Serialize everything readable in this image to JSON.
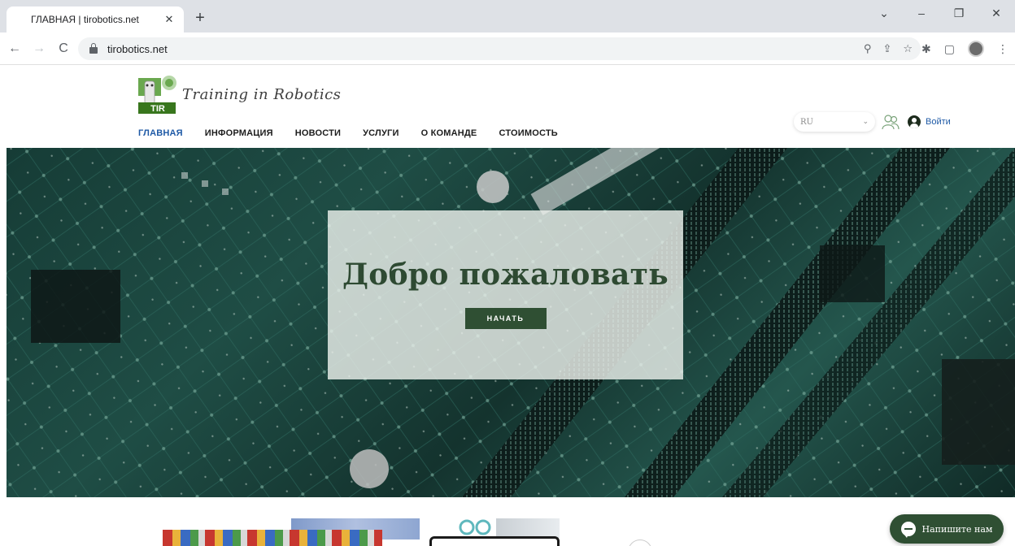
{
  "browser": {
    "tab_title": "ГЛАВНАЯ | tirobotics.net",
    "tab_close": "✕",
    "new_tab": "+",
    "url": "tirobotics.net",
    "window_controls": [
      "⌄",
      "–",
      "❐",
      "✕"
    ]
  },
  "site": {
    "brand": "Training in Robotics",
    "logo_text": "TIR",
    "menu": [
      {
        "label": "ГЛАВНАЯ",
        "active": true
      },
      {
        "label": "ИНФОРМАЦИЯ",
        "active": false
      },
      {
        "label": "НОВОСТИ",
        "active": false
      },
      {
        "label": "УСЛУГИ",
        "active": false
      },
      {
        "label": "О КОМАНДЕ",
        "active": false
      },
      {
        "label": "СТОИМОСТЬ",
        "active": false
      }
    ],
    "language": "RU",
    "login_label": "Войти"
  },
  "hero": {
    "title": "Добро пожаловать",
    "button_label": "НАЧАТЬ"
  },
  "chat": {
    "label": "Напишите нам"
  },
  "colors": {
    "accent_green": "#2f4f33",
    "active_menu_blue": "#1f5aa6"
  }
}
